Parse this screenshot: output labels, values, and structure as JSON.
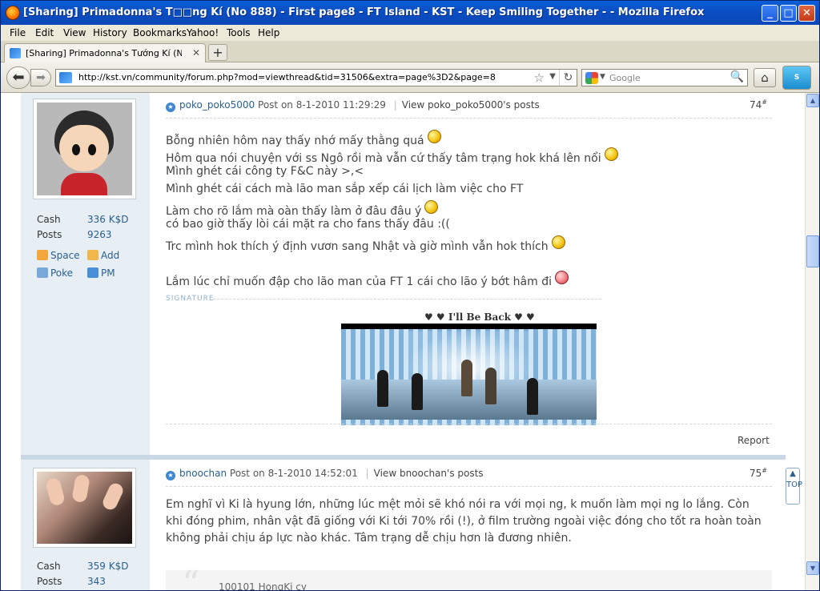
{
  "window": {
    "title": "[Sharing] Primadonna's T□□ng Kí (No 888) - First page8 - FT Island - KST - Keep Smiling Together - - Mozilla Firefox"
  },
  "menu": [
    "File",
    "Edit",
    "View",
    "History",
    "Bookmarks",
    "Yahoo!",
    "Tools",
    "Help"
  ],
  "tab": {
    "label": "[Sharing] Primadonna's Tướng Kí (No 888) - ..."
  },
  "nav": {
    "url": "http://kst.vn/community/forum.php?mod=viewthread&tid=31506&extra=page%3D2&page=8",
    "search_placeholder": "Google"
  },
  "post1": {
    "author": "poko_poko5000",
    "posted": "Post on 8-1-2010 11:29:29",
    "view_posts": "View poko_poko5000's posts",
    "floor": "74",
    "cash_label": "Cash",
    "cash_value": "336 K$D",
    "posts_label": "Posts",
    "posts_value": "9263",
    "actions": {
      "space": "Space",
      "add": "Add",
      "poke": "Poke",
      "pm": "PM"
    },
    "lines": [
      "Bỗng nhiên hôm nay thấy nhớ mấy thằng quá",
      "Hôm qua nói chuyện với ss Ngô rồi mà vẫn cứ thấy tâm trạng hok khá lên nổi",
      "Mình ghét cái công ty F&C này >,<",
      "Mình ghét cái cách mà lão man sắp xếp cái lịch làm việc cho FT",
      "Làm cho rõ lắm mà oàn thấy làm ở đâu đâu ý",
      "có bao giờ thấy lòi cái mặt ra cho fans thấy đâu :((",
      "Trc mình hok thích ý định vươn sang Nhật và giờ mình vẫn hok thích",
      "Lắm lúc chỉ muốn đập cho  lão man của FT 1 cái cho lão ý bớt hâm đi"
    ],
    "signature_label": "SIGNATURE",
    "signature_title": "♥ ♥ I'll Be Back ♥ ♥",
    "report": "Report"
  },
  "post2": {
    "author": "bnoochan",
    "posted": "Post on 8-1-2010 14:52:01",
    "view_posts": "View bnoochan's posts",
    "floor": "75",
    "cash_label": "Cash",
    "cash_value": "359 K$D",
    "posts_label": "Posts",
    "posts_value": "343",
    "text": "Em nghĩ vì Ki là hyung lớn, những lúc mệt mỏi sẽ khó nói ra với mọi ng, k muốn làm mọi ng lo lắng. Còn khi đóng phim, nhân vật đã giống với Ki tới 70% rồi (!), ở film trường ngoài việc đóng cho tốt ra hoàn toàn không phải chịu áp lực nào khác. Tâm trạng dễ chịu hơn là đương nhiên.",
    "quote_preview": "100101 HongKi cy"
  },
  "back_to_top": "TOP"
}
